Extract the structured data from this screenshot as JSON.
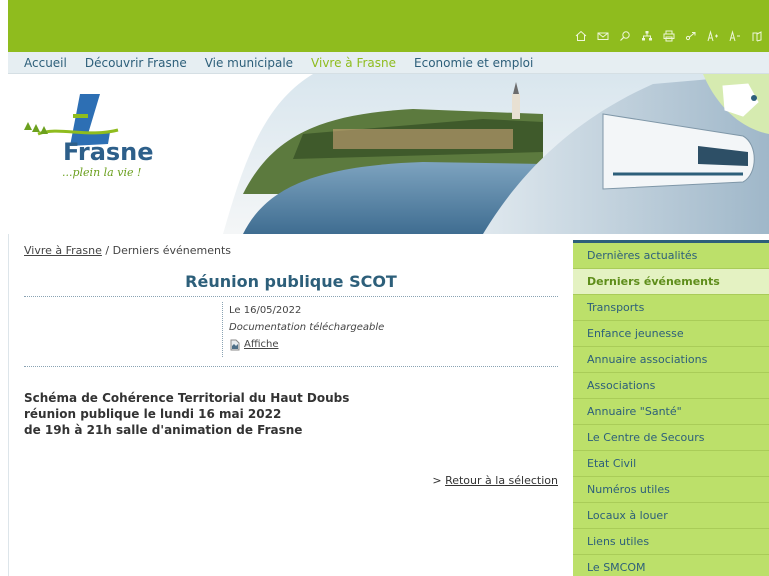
{
  "nav": {
    "items": [
      "Accueil",
      "Découvrir Frasne",
      "Vie municipale",
      "Vivre à Frasne",
      "Economie et emploi"
    ],
    "active_index": 3
  },
  "toolbar": {
    "icons": [
      "home-icon",
      "mail-icon",
      "search-icon",
      "sitemap-icon",
      "print-icon",
      "share-icon",
      "font-increase-icon",
      "font-decrease-icon",
      "exit-icon"
    ]
  },
  "banner": {
    "brand": "Frasne",
    "tagline": "...plein la vie !"
  },
  "breadcrumb": {
    "parent": "Vivre à Frasne",
    "separator": " / ",
    "current": "Derniers événements"
  },
  "event": {
    "title": "Réunion publique SCOT",
    "date": "Le 16/05/2022",
    "doc_label": "Documentation téléchargeable",
    "attachment": "Affiche",
    "lines": [
      "Schéma de Cohérence Territorial du Haut Doubs",
      "réunion publique le lundi 16 mai 2022",
      "de 19h à 21h salle d'animation de Frasne"
    ],
    "back_prefix": "> ",
    "back_link": "Retour à la sélection"
  },
  "sidebar": {
    "items": [
      "Dernières actualités",
      "Derniers événements",
      "Transports",
      "Enfance jeunesse",
      "Annuaire associations",
      "Associations",
      "Annuaire \"Santé\"",
      "Le Centre de Secours",
      "Etat Civil",
      "Numéros utiles",
      "Locaux à louer",
      "Liens utiles",
      "Le SMCOM"
    ],
    "active_index": 1
  },
  "colors": {
    "brand_green": "#8fbc1e",
    "nav_blue": "#2d5f7a",
    "sidebar_green": "#bce06a"
  }
}
